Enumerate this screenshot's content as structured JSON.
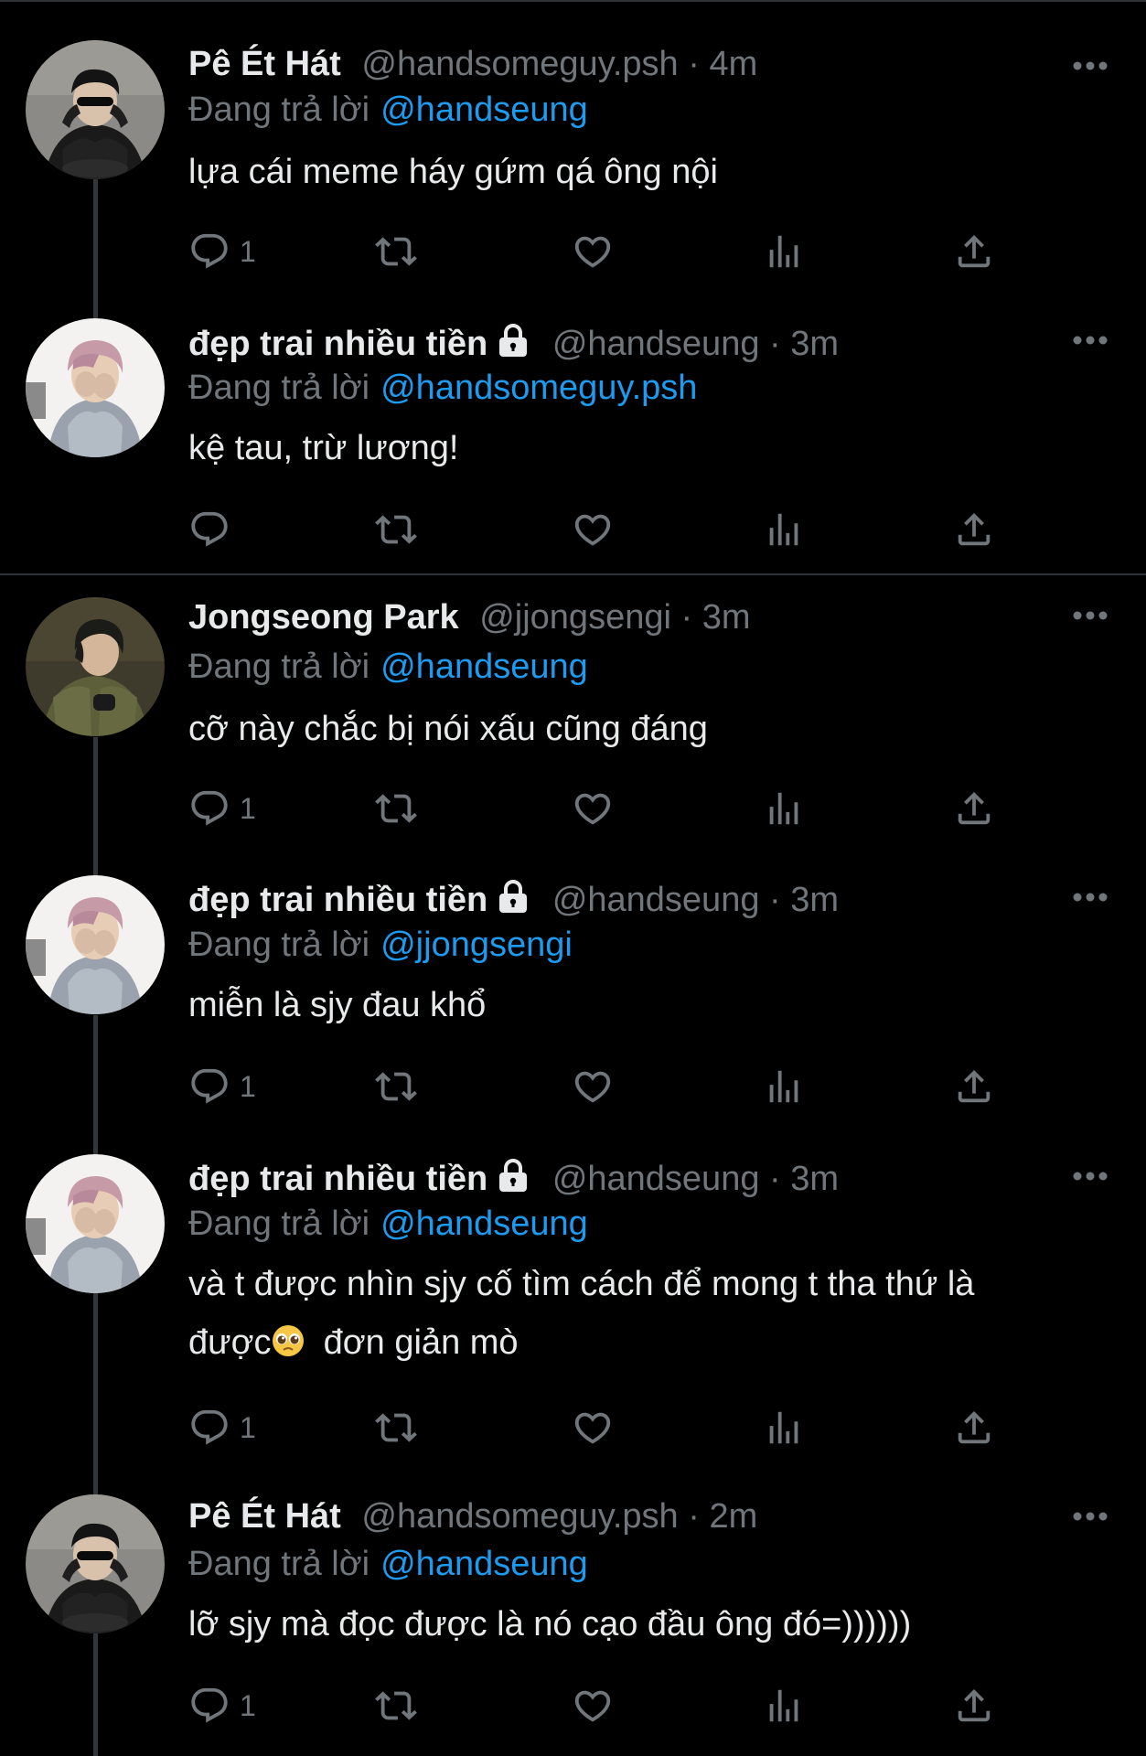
{
  "colors": {
    "background": "#000000",
    "text": "#e7e9ea",
    "muted": "#71767b",
    "link": "#1d9bf0",
    "divider": "#2f3336"
  },
  "tweets": [
    {
      "name": "Pê Ét Hát",
      "handle": "@handsomeguy.psh",
      "dot": "·",
      "time": "4m",
      "reply_label": "Đang trả lời",
      "reply_to": "@handseung",
      "text": "lựa cái meme háy gứm qá ông nội",
      "reply_count": "1",
      "locked": false,
      "avatar": "avatar-sunglasses-black-outfit"
    },
    {
      "name": "đẹp trai nhiều tiền",
      "handle": "@handseung",
      "dot": "·",
      "time": "3m",
      "reply_label": "Đang trả lời",
      "reply_to": "@handsomeguy.psh",
      "text": "kệ tau, trừ lương!",
      "reply_count": "",
      "locked": true,
      "avatar": "avatar-pink-hair-grey-sweater"
    },
    {
      "name": "Jongseong Park",
      "handle": "@jjongsengi",
      "dot": "·",
      "time": "3m",
      "reply_label": "Đang trả lời",
      "reply_to": "@handseung",
      "text": "cỡ này chắc bị nói xấu cũng đáng",
      "reply_count": "1",
      "locked": false,
      "avatar": "avatar-green-jacket"
    },
    {
      "name": "đẹp trai nhiều tiền",
      "handle": "@handseung",
      "dot": "·",
      "time": "3m",
      "reply_label": "Đang trả lời",
      "reply_to": "@jjongsengi",
      "text": "miễn là sjy đau khổ",
      "reply_count": "1",
      "locked": true,
      "avatar": "avatar-pink-hair-grey-sweater"
    },
    {
      "name": "đẹp trai nhiều tiền",
      "handle": "@handseung",
      "dot": "·",
      "time": "3m",
      "reply_label": "Đang trả lời",
      "reply_to": "@handseung",
      "text_line1": "và t được nhìn sjy cố tìm cách để mong t tha thứ là",
      "text_line2a": "được",
      "emoji": "pleading-face-emoji",
      "text_line2b": "  đơn giản mò",
      "reply_count": "1",
      "locked": true,
      "avatar": "avatar-pink-hair-grey-sweater"
    },
    {
      "name": "Pê Ét Hát",
      "handle": "@handsomeguy.psh",
      "dot": "·",
      "time": "2m",
      "reply_label": "Đang trả lời",
      "reply_to": "@handseung",
      "text": "lỡ sjy mà đọc được là nó cạo đầu ông đó=))))))",
      "reply_count": "1",
      "locked": false,
      "avatar": "avatar-sunglasses-black-outfit"
    }
  ],
  "icons": {
    "reply": "reply-icon",
    "retweet": "retweet-icon",
    "like": "heart-icon",
    "views": "views-icon",
    "share": "share-icon",
    "more": "more-icon",
    "lock": "lock-icon"
  }
}
